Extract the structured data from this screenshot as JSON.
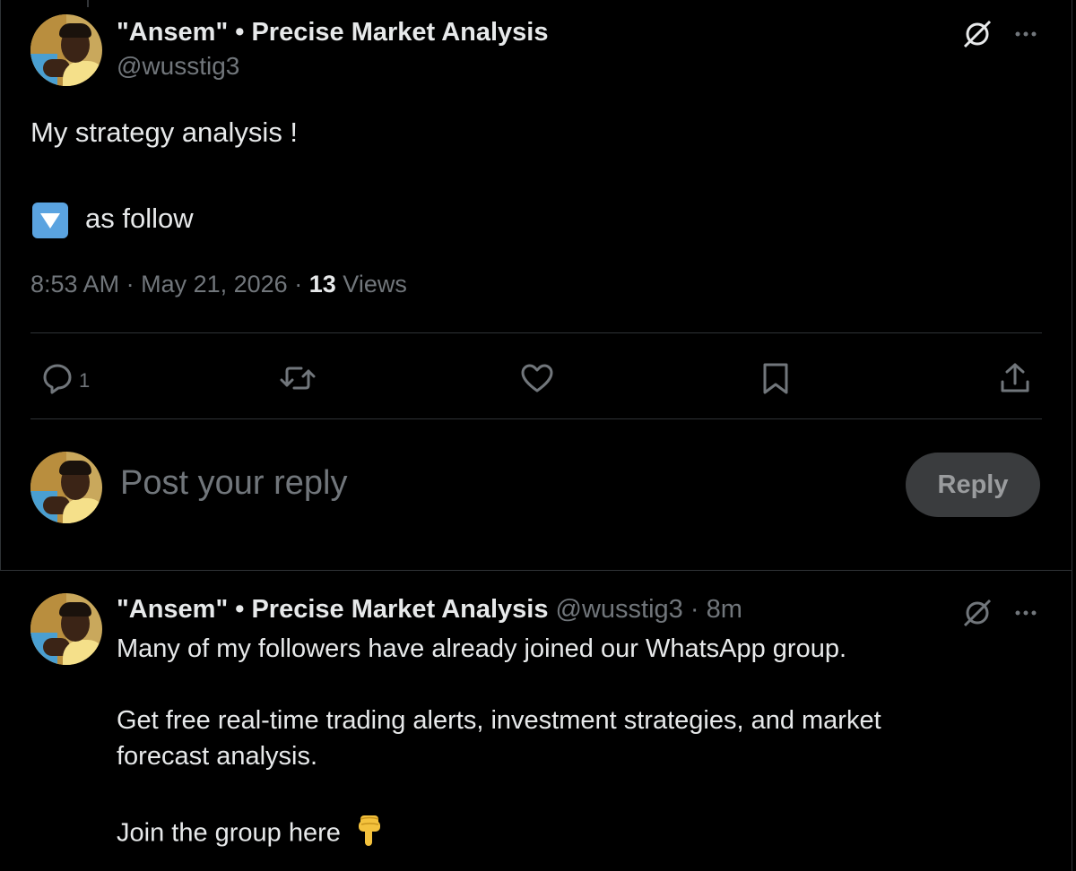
{
  "tweet": {
    "author": {
      "display_name": "\"Ansem\" • Precise Market Analysis",
      "handle": "@wusstig3"
    },
    "text_line1": "My strategy analysis !",
    "text_line2": "as follow",
    "emoji": "down-button-emoji",
    "time": "8:53 AM",
    "date": "May 21, 2026",
    "views_count": "13",
    "views_label": "Views",
    "separator": "·",
    "actions": {
      "reply_count": "1"
    }
  },
  "composer": {
    "placeholder": "Post your reply",
    "reply_button_label": "Reply"
  },
  "reply": {
    "author": {
      "display_name": "\"Ansem\" • Precise Market Analysis",
      "handle": "@wusstig3"
    },
    "separator": "·",
    "time_ago": "8m",
    "line1": "Many of my followers have already joined our WhatsApp group.",
    "line2": "Get free real-time trading alerts, investment strategies, and market",
    "line3": "forecast analysis.",
    "line4": "Join the group here"
  },
  "icons": {
    "grok": "grok-icon",
    "more": "more-icon",
    "reply": "reply-icon",
    "repost": "repost-icon",
    "like": "heart-icon",
    "bookmark": "bookmark-icon",
    "share": "share-icon",
    "pointing_down": "backhand-index-pointing-down-emoji"
  },
  "colors": {
    "background": "#000000",
    "text_primary": "#e7e9ea",
    "text_secondary": "#71767b",
    "divider": "#2f3336",
    "emoji_blue": "#5aa3e0",
    "reply_button_bg": "#3a3c3e"
  }
}
